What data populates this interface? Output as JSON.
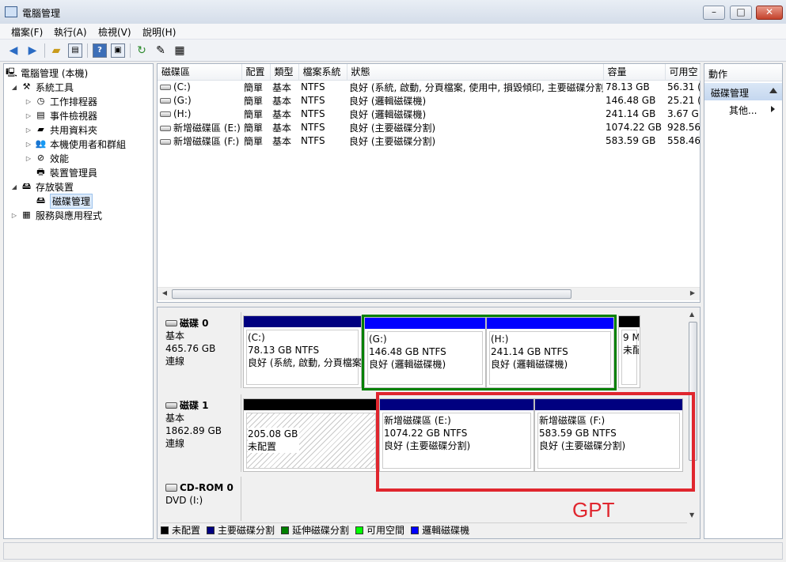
{
  "window": {
    "title": "電腦管理",
    "min": "0",
    "max": "1",
    "close": "x"
  },
  "menu": [
    "檔案(F)",
    "執行(A)",
    "檢視(V)",
    "說明(H)"
  ],
  "toolbar_icons": [
    "back-arrow-icon",
    "forward-arrow-icon",
    "up-folder-icon",
    "show-tree-icon",
    "help-icon",
    "console-icon",
    "refresh-icon",
    "properties-icon",
    "export-icon"
  ],
  "tree": {
    "root": "電腦管理 (本機)",
    "system_tools": "系統工具",
    "task_scheduler": "工作排程器",
    "event_viewer": "事件檢視器",
    "shared_folders": "共用資料夾",
    "local_users": "本機使用者和群組",
    "performance": "效能",
    "device_manager": "裝置管理員",
    "storage": "存放裝置",
    "disk_management": "磁碟管理",
    "services": "服務與應用程式"
  },
  "volume_table": {
    "headers": [
      "磁碟區",
      "配置",
      "類型",
      "檔案系統",
      "狀態",
      "容量",
      "可用空"
    ],
    "rows": [
      [
        "(C:)",
        "簡單",
        "基本",
        "NTFS",
        "良好 (系統, 啟動, 分頁檔案, 使用中, 損毀傾印, 主要磁碟分割)",
        "78.13 GB",
        "56.31 ("
      ],
      [
        "(G:)",
        "簡單",
        "基本",
        "NTFS",
        "良好 (邏輯磁碟機)",
        "146.48 GB",
        "25.21 ("
      ],
      [
        "(H:)",
        "簡單",
        "基本",
        "NTFS",
        "良好 (邏輯磁碟機)",
        "241.14 GB",
        "3.67 G"
      ],
      [
        "新增磁碟區 (E:)",
        "簡單",
        "基本",
        "NTFS",
        "良好 (主要磁碟分割)",
        "1074.22 GB",
        "928.56"
      ],
      [
        "新增磁碟區 (F:)",
        "簡單",
        "基本",
        "NTFS",
        "良好 (主要磁碟分割)",
        "583.59 GB",
        "558.46"
      ]
    ]
  },
  "disks": {
    "disk0": {
      "name": "磁碟 0",
      "type": "基本",
      "size": "465.76 GB",
      "status": "連線",
      "partitions": [
        {
          "name": "(C:)",
          "size": "78.13 GB NTFS",
          "status": "良好 (系統, 啟動, 分頁檔案"
        },
        {
          "name": "(G:)",
          "size": "146.48 GB NTFS",
          "status": "良好 (邏輯磁碟機)"
        },
        {
          "name": "(H:)",
          "size": "241.14 GB NTFS",
          "status": "良好 (邏輯磁碟機)"
        },
        {
          "name": "",
          "size": "9 M",
          "status": "未配"
        }
      ]
    },
    "disk1": {
      "name": "磁碟 1",
      "type": "基本",
      "size": "1862.89 GB",
      "status": "連線",
      "partitions": [
        {
          "name": "",
          "size": "205.08 GB",
          "status": "未配置"
        },
        {
          "name": "新增磁碟區 (E:)",
          "size": "1074.22 GB NTFS",
          "status": "良好 (主要磁碟分割)"
        },
        {
          "name": "新增磁碟區 (F:)",
          "size": "583.59 GB NTFS",
          "status": "良好 (主要磁碟分割)"
        }
      ]
    },
    "cdrom0": {
      "name": "CD-ROM 0",
      "drive": "DVD (I:)"
    }
  },
  "legend": [
    {
      "label": "未配置",
      "color": "#000000"
    },
    {
      "label": "主要磁碟分割",
      "color": "#000080"
    },
    {
      "label": "延伸磁碟分割",
      "color": "#008000"
    },
    {
      "label": "可用空間",
      "color": "#00ff00"
    },
    {
      "label": "邏輯磁碟機",
      "color": "#0000ff"
    }
  ],
  "actions": {
    "header": "動作",
    "section": "磁碟管理",
    "more": "其他..."
  },
  "annotation": {
    "label": "GPT",
    "color": "#e0262e"
  },
  "colors": {
    "extended_partition": "#008000",
    "primary": "#000080",
    "logical": "#0000ff",
    "unallocated": "#000000"
  }
}
